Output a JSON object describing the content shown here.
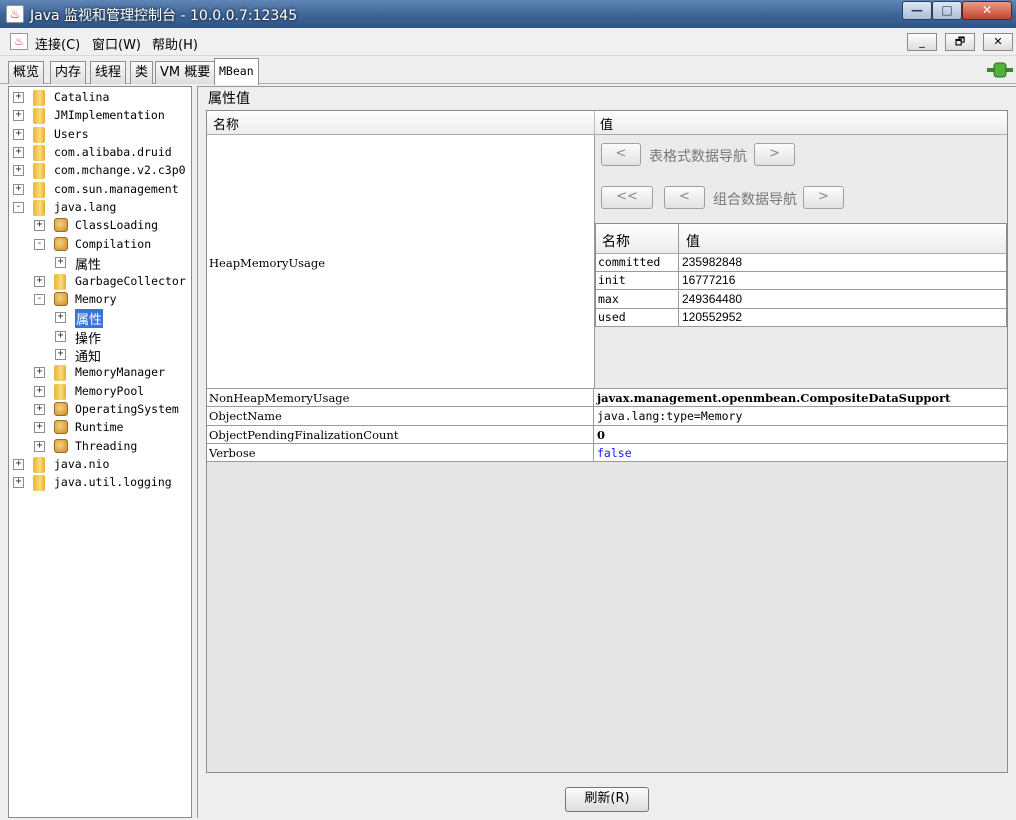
{
  "window": {
    "title": "Java 监视和管理控制台 - 10.0.0.7:12345",
    "app_icon": "java-icon",
    "controls": {
      "minimize": "—",
      "maximize": "□",
      "close": "✕"
    }
  },
  "menu": {
    "connect": "连接(C)",
    "window": "窗口(W)",
    "help": "帮助(H)",
    "inner_controls": {
      "minimize": "_",
      "restore": "🗗",
      "close": "✕"
    }
  },
  "tabs": [
    "概览",
    "内存",
    "线程",
    "类",
    "VM 概要",
    "MBean"
  ],
  "active_tab": "MBean",
  "tree": {
    "nodes": [
      {
        "label": "Catalina",
        "icon": "folder-icon",
        "toggle": "+"
      },
      {
        "label": "JMImplementation",
        "icon": "folder-icon",
        "toggle": "+"
      },
      {
        "label": "Users",
        "icon": "folder-icon",
        "toggle": "+"
      },
      {
        "label": "com.alibaba.druid",
        "icon": "folder-icon",
        "toggle": "+"
      },
      {
        "label": "com.mchange.v2.c3p0",
        "icon": "folder-icon",
        "toggle": "+"
      },
      {
        "label": "com.sun.management",
        "icon": "folder-icon",
        "toggle": "+"
      },
      {
        "label": "java.lang",
        "icon": "folder-icon",
        "toggle": "-"
      },
      {
        "label": "ClassLoading",
        "icon": "bean-icon",
        "toggle": "+"
      },
      {
        "label": "Compilation",
        "icon": "bean-icon",
        "toggle": "-"
      },
      {
        "label": "属性",
        "icon": "",
        "toggle": "+"
      },
      {
        "label": "GarbageCollector",
        "icon": "folder-icon",
        "toggle": "+"
      },
      {
        "label": "Memory",
        "icon": "bean-icon",
        "toggle": "-"
      },
      {
        "label": "属性",
        "icon": "",
        "toggle": "+"
      },
      {
        "label": "操作",
        "icon": "",
        "toggle": "+"
      },
      {
        "label": "通知",
        "icon": "",
        "toggle": "+"
      },
      {
        "label": "MemoryManager",
        "icon": "folder-icon",
        "toggle": "+"
      },
      {
        "label": "MemoryPool",
        "icon": "folder-icon",
        "toggle": "+"
      },
      {
        "label": "OperatingSystem",
        "icon": "bean-icon",
        "toggle": "+"
      },
      {
        "label": "Runtime",
        "icon": "bean-icon",
        "toggle": "+"
      },
      {
        "label": "Threading",
        "icon": "bean-icon",
        "toggle": "+"
      },
      {
        "label": "java.nio",
        "icon": "folder-icon",
        "toggle": "+"
      },
      {
        "label": "java.util.logging",
        "icon": "folder-icon",
        "toggle": "+"
      }
    ],
    "selected": "Memory / 属性"
  },
  "attributes": {
    "section_title": "属性值",
    "header": {
      "name": "名称",
      "value": "值"
    },
    "heap_usage": {
      "name": "HeapMemoryUsage",
      "tabular_nav_label": "表格式数据导航",
      "composite_nav_label": "组合数据导航",
      "prev": "<",
      "next": ">",
      "first": "<<",
      "table_header": {
        "name": "名称",
        "value": "值"
      },
      "rows": [
        {
          "key": "committed",
          "value": "235982848"
        },
        {
          "key": "init",
          "value": "16777216"
        },
        {
          "key": "max",
          "value": "249364480"
        },
        {
          "key": "used",
          "value": "120552952"
        }
      ]
    },
    "rows": [
      {
        "name": "NonHeapMemoryUsage",
        "value": "javax.management.openmbean.CompositeDataSupport"
      },
      {
        "name": "ObjectName",
        "value": "java.lang:type=Memory"
      },
      {
        "name": "ObjectPendingFinalizationCount",
        "value": "0"
      },
      {
        "name": "Verbose",
        "value": "false"
      }
    ]
  },
  "refresh_button": "刷新(R)",
  "colors": {
    "selection": "#3875d7",
    "link_value": "#1a1aff",
    "title_bar": "#3e6497"
  }
}
